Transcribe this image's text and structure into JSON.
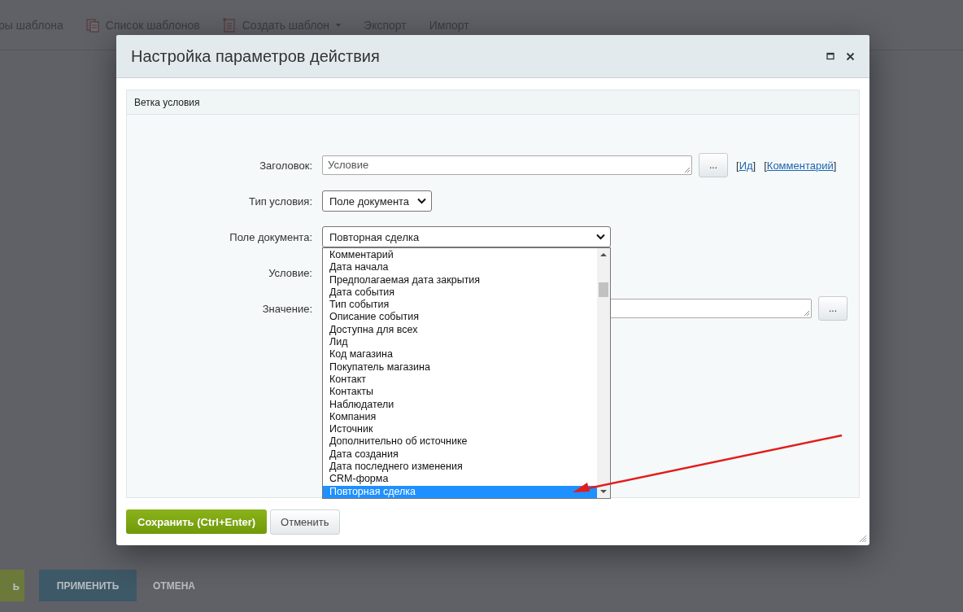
{
  "background": {
    "toolbar": [
      {
        "label": "ры шаблона",
        "kind": "text"
      },
      {
        "label": "Список шаблонов",
        "kind": "list"
      },
      {
        "label": "Создать шаблон",
        "kind": "create"
      },
      {
        "label": "Экспорт",
        "kind": "text"
      },
      {
        "label": "Импорт",
        "kind": "text"
      }
    ],
    "bottom_buttons": [
      {
        "label": "ь",
        "kind": "save"
      },
      {
        "label": "ПРИМЕНИТЬ",
        "kind": "apply"
      },
      {
        "label": "ОТМЕНА",
        "kind": "cancel"
      }
    ]
  },
  "dialog": {
    "title": "Настройка параметров действия",
    "section_title": "Ветка условия",
    "fields": [
      {
        "kind": "textarea",
        "label": "Заголовок:",
        "value": "Условие",
        "button": "...",
        "links": [
          {
            "open": "[",
            "text": "Ид",
            "close": "]"
          },
          {
            "open": "[",
            "text": "Комментарий",
            "close": "]"
          }
        ]
      },
      {
        "kind": "select",
        "label": "Тип условия:",
        "value": "Поле документа"
      },
      {
        "kind": "select-open",
        "label": "Поле документа:",
        "value": "Повторная сделка",
        "options": [
          {
            "label": "Комментарий",
            "selected": false
          },
          {
            "label": "Дата начала",
            "selected": false
          },
          {
            "label": "Предполагаемая дата закрытия",
            "selected": false
          },
          {
            "label": "Дата события",
            "selected": false
          },
          {
            "label": "Тип события",
            "selected": false
          },
          {
            "label": "Описание события",
            "selected": false
          },
          {
            "label": "Доступна для всех",
            "selected": false
          },
          {
            "label": "Лид",
            "selected": false
          },
          {
            "label": "Код магазина",
            "selected": false
          },
          {
            "label": "Покупатель магазина",
            "selected": false
          },
          {
            "label": "Контакт",
            "selected": false
          },
          {
            "label": "Контакты",
            "selected": false
          },
          {
            "label": "Наблюдатели",
            "selected": false
          },
          {
            "label": "Компания",
            "selected": false
          },
          {
            "label": "Источник",
            "selected": false
          },
          {
            "label": "Дополнительно об источнике",
            "selected": false
          },
          {
            "label": "Дата создания",
            "selected": false
          },
          {
            "label": "Дата последнего изменения",
            "selected": false
          },
          {
            "label": "CRM-форма",
            "selected": false
          },
          {
            "label": "Повторная сделка",
            "selected": true
          }
        ]
      },
      {
        "kind": "covered",
        "label": "Условие:"
      },
      {
        "kind": "textarea-wide",
        "label": "Значение:",
        "button": "..."
      }
    ],
    "save_button": "Сохранить (Ctrl+Enter)",
    "cancel_button": "Отменить"
  }
}
